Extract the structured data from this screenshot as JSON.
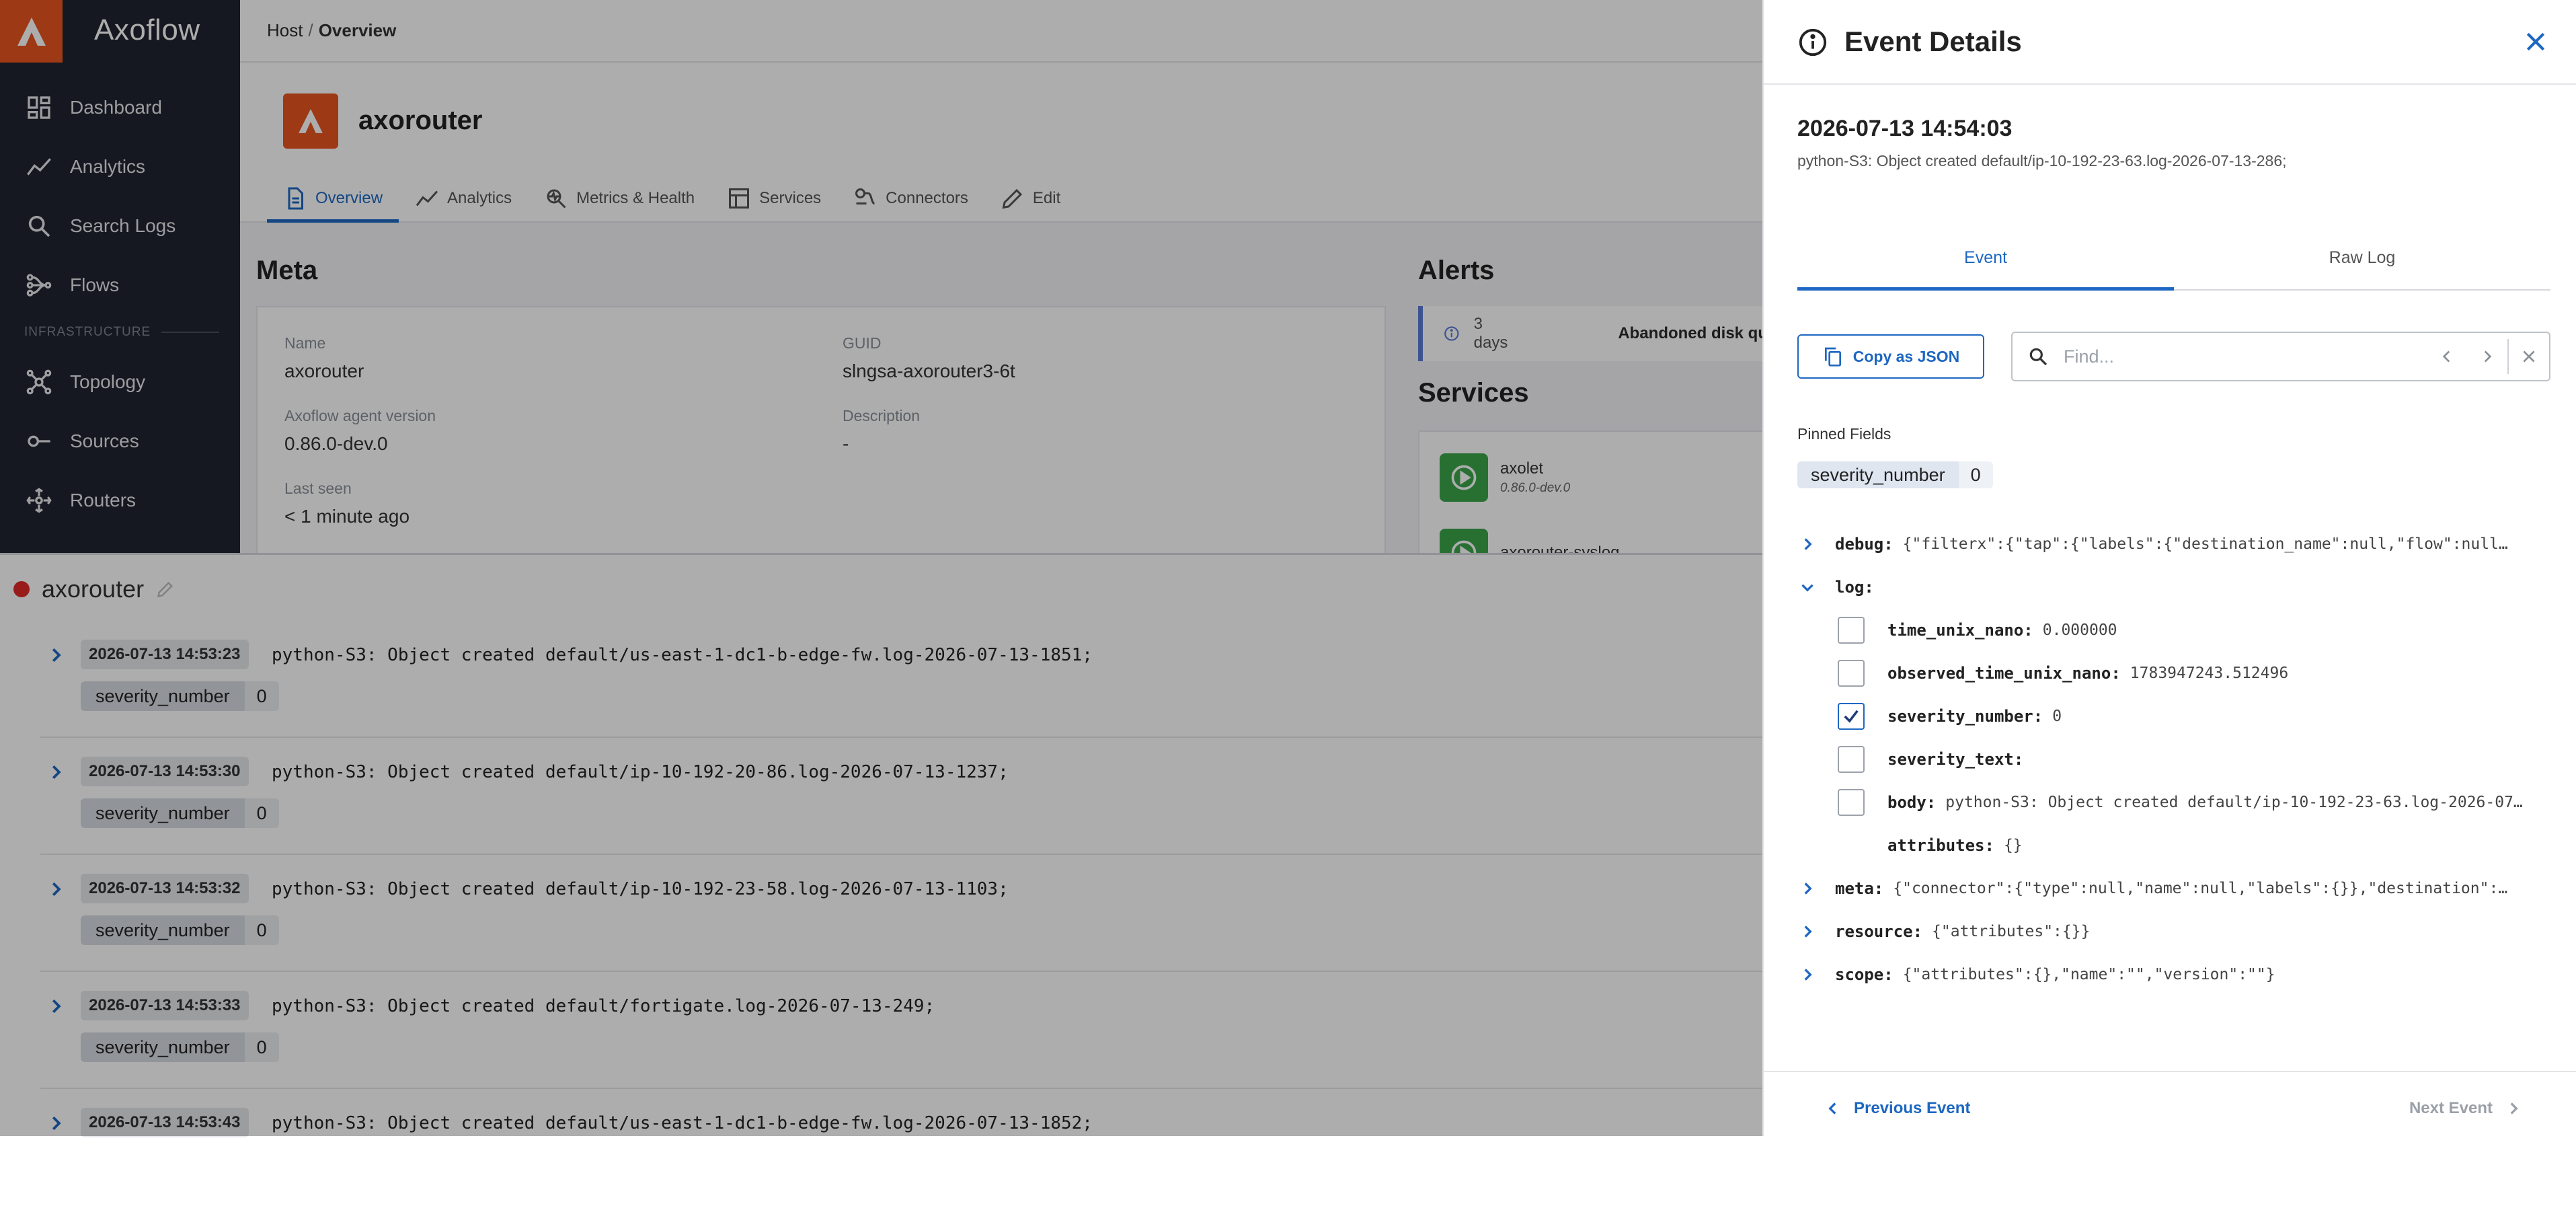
{
  "app": {
    "brand": "Axoflow"
  },
  "sidebar": {
    "items": [
      {
        "label": "Dashboard",
        "icon": "dashboard-icon"
      },
      {
        "label": "Analytics",
        "icon": "analytics-icon"
      },
      {
        "label": "Search Logs",
        "icon": "search-icon"
      },
      {
        "label": "Flows",
        "icon": "flows-icon"
      }
    ],
    "section_label": "INFRASTRUCTURE",
    "infra_items": [
      {
        "label": "Topology",
        "icon": "topology-icon"
      },
      {
        "label": "Sources",
        "icon": "sources-icon"
      },
      {
        "label": "Routers",
        "icon": "routers-icon"
      }
    ]
  },
  "breadcrumb": {
    "parent": "Host",
    "separator": "/",
    "current": "Overview"
  },
  "host": {
    "name": "axorouter",
    "tabs": [
      {
        "label": "Overview",
        "icon": "overview-icon",
        "active": true
      },
      {
        "label": "Analytics",
        "icon": "analytics-icon"
      },
      {
        "label": "Metrics & Health",
        "icon": "metrics-icon"
      },
      {
        "label": "Services",
        "icon": "services-icon"
      },
      {
        "label": "Connectors",
        "icon": "connectors-icon"
      },
      {
        "label": "Edit",
        "icon": "edit-icon"
      }
    ]
  },
  "meta": {
    "title": "Meta",
    "fields": {
      "name_label": "Name",
      "name_value": "axorouter",
      "guid_label": "GUID",
      "guid_value": "slngsa-axorouter3-6t",
      "agent_label": "Axoflow agent version",
      "agent_value": "0.86.0-dev.0",
      "desc_label": "Description",
      "desc_value": "-",
      "seen_label": "Last seen",
      "seen_value": "< 1 minute ago"
    }
  },
  "alerts": {
    "title": "Alerts",
    "row": {
      "age": "3 days",
      "message": "Abandoned disk qu"
    }
  },
  "services": {
    "title": "Services",
    "items": [
      {
        "name": "axolet",
        "version": "0.86.0-dev.0"
      },
      {
        "name": "axorouter-syslog"
      }
    ]
  },
  "logs": {
    "host": "axorouter",
    "status_color": "#e02a2a",
    "rows": [
      {
        "ts": "2026-07-13 14:53:23",
        "text": "python-S3: Object created default/us-east-1-dc1-b-edge-fw.log-2026-07-13-1851;",
        "pill_key": "severity_number",
        "pill_val": "0"
      },
      {
        "ts": "2026-07-13 14:53:30",
        "text": "python-S3: Object created default/ip-10-192-20-86.log-2026-07-13-1237;",
        "pill_key": "severity_number",
        "pill_val": "0"
      },
      {
        "ts": "2026-07-13 14:53:32",
        "text": "python-S3: Object created default/ip-10-192-23-58.log-2026-07-13-1103;",
        "pill_key": "severity_number",
        "pill_val": "0"
      },
      {
        "ts": "2026-07-13 14:53:33",
        "text": "python-S3: Object created default/fortigate.log-2026-07-13-249;",
        "pill_key": "severity_number",
        "pill_val": "0"
      },
      {
        "ts": "2026-07-13 14:53:43",
        "text": "python-S3: Object created default/us-east-1-dc1-b-edge-fw.log-2026-07-13-1852;"
      }
    ]
  },
  "drawer": {
    "title": "Event Details",
    "timestamp": "2026-07-13 14:54:03",
    "subtitle": "python-S3: Object created default/ip-10-192-23-63.log-2026-07-13-286;",
    "tabs": [
      {
        "label": "Event",
        "active": true
      },
      {
        "label": "Raw Log"
      }
    ],
    "copy_label": "Copy as JSON",
    "find_placeholder": "Find...",
    "pinned_label": "Pinned Fields",
    "pinned": {
      "key": "severity_number",
      "value": "0"
    },
    "tree": {
      "debug_key": "debug:",
      "debug_val": "{\"filterx\":{\"tap\":{\"labels\":{\"destination_name\":null,\"flow\":null…",
      "log_key": "log:",
      "log_fields": [
        {
          "key": "time_unix_nano:",
          "value": "0.000000",
          "checked": false
        },
        {
          "key": "observed_time_unix_nano:",
          "value": "1783947243.512496",
          "checked": false
        },
        {
          "key": "severity_number:",
          "value": "0",
          "checked": true
        },
        {
          "key": "severity_text:",
          "value": "",
          "checked": false
        },
        {
          "key": "body:",
          "value": "python-S3: Object created default/ip-10-192-23-63.log-2026-07…",
          "checked": false
        },
        {
          "key": "attributes:",
          "value": "{}"
        }
      ],
      "meta_key": "meta:",
      "meta_val": "{\"connector\":{\"type\":null,\"name\":null,\"labels\":{}},\"destination\":…",
      "resource_key": "resource:",
      "resource_val": "{\"attributes\":{}}",
      "scope_key": "scope:",
      "scope_val": "{\"attributes\":{},\"name\":\"\",\"version\":\"\"}"
    },
    "prev_label": "Previous Event",
    "next_label": "Next Event"
  },
  "colors": {
    "accent": "#1d67c2",
    "brand": "#e8541f",
    "sidebar": "#1f2430",
    "service_ok": "#3aa64b"
  }
}
